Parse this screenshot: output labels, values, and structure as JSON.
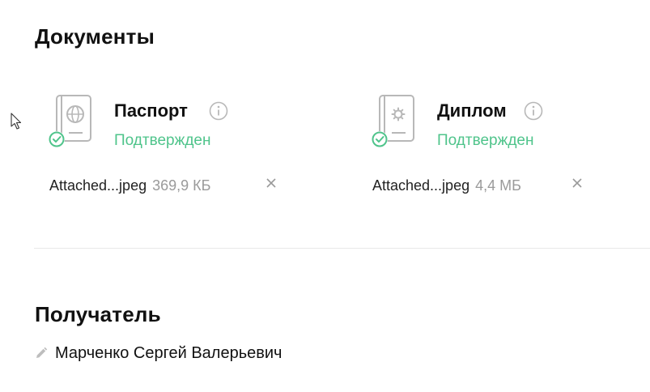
{
  "documents": {
    "title": "Документы",
    "items": [
      {
        "name": "Паспорт",
        "status": "Подтвержден",
        "icon": "passport-globe-icon",
        "file_name": "Attached...jpeg",
        "file_size": "369,9 КБ"
      },
      {
        "name": "Диплом",
        "status": "Подтвержден",
        "icon": "diploma-seal-icon",
        "file_name": "Attached...jpeg",
        "file_size": "4,4 МБ"
      }
    ]
  },
  "recipient": {
    "title": "Получатель",
    "name": "Марченко Сергей Валерьевич",
    "edit_icon": "pencil-icon"
  },
  "colors": {
    "status_green": "#4fc48b",
    "icon_gray": "#b8b8b8",
    "muted_text": "#9a9a9a",
    "divider": "#e8e8e8"
  }
}
